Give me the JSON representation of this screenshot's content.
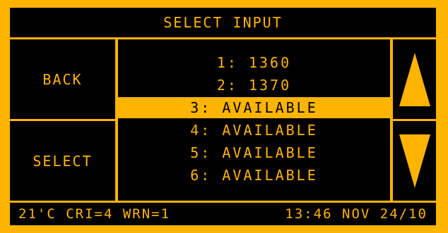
{
  "title": "SELECT INPUT",
  "buttons": {
    "back": "BACK",
    "select": "SELECT",
    "up_icon": "triangle-up",
    "down_icon": "triangle-down"
  },
  "list": {
    "items": [
      {
        "label": "1: 1360"
      },
      {
        "label": "2: 1370"
      },
      {
        "label": "3: AVAILABLE",
        "selected": true
      },
      {
        "label": "4: AVAILABLE"
      },
      {
        "label": "5: AVAILABLE"
      },
      {
        "label": "6: AVAILABLE"
      }
    ]
  },
  "status": {
    "left": "21'C CRI=4 WRN=1",
    "right": "13:46 NOV 24/10"
  },
  "colors": {
    "accent": "#ffb400",
    "background": "#000000"
  }
}
